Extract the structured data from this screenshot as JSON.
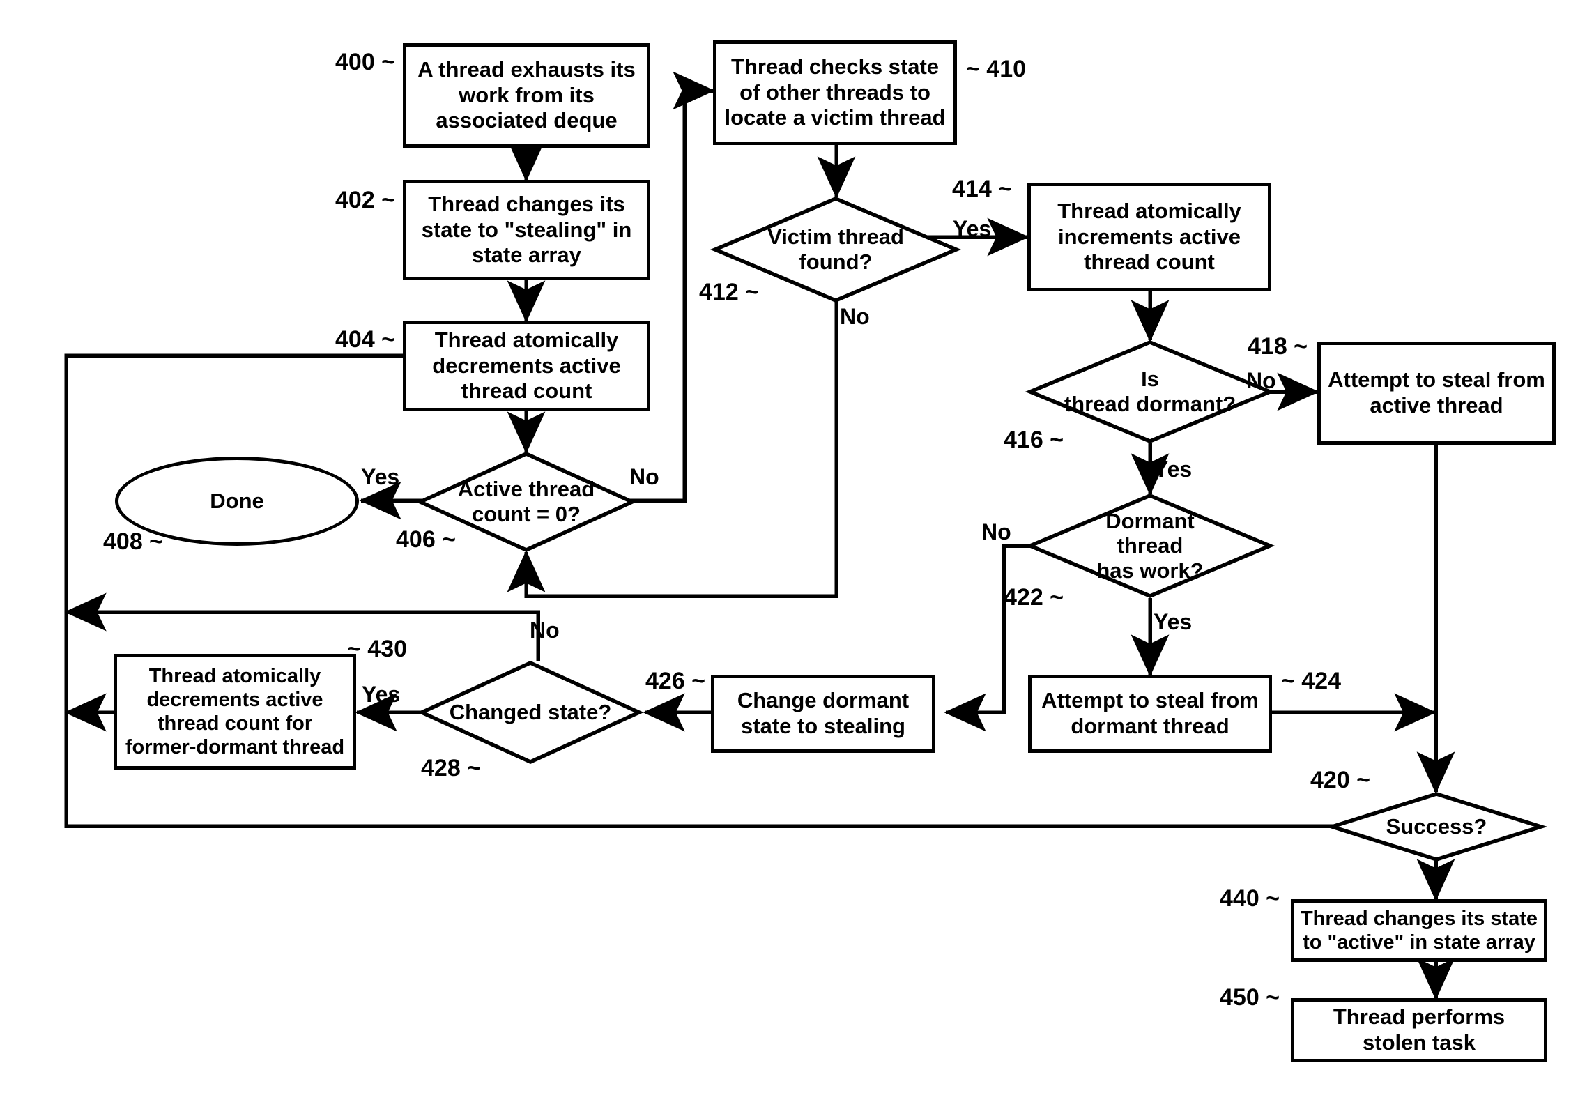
{
  "diagram": {
    "type": "flowchart",
    "title": "Work-stealing thread flow diagram",
    "nodes": [
      {
        "id": "400",
        "ref": "400 ~",
        "shape": "process",
        "text": "A thread exhausts its work from its associated deque"
      },
      {
        "id": "402",
        "ref": "402 ~",
        "shape": "process",
        "text": "Thread changes its state to \"stealing\" in state array"
      },
      {
        "id": "404",
        "ref": "404 ~",
        "shape": "process",
        "text": "Thread atomically decrements active thread count"
      },
      {
        "id": "406",
        "ref": "406 ~",
        "shape": "decision",
        "text": "Active thread\ncount = 0?"
      },
      {
        "id": "408",
        "ref": "408 ~",
        "shape": "terminal",
        "text": "Done"
      },
      {
        "id": "410",
        "ref": "~ 410",
        "shape": "process",
        "text": "Thread checks state of other threads to locate a victim thread"
      },
      {
        "id": "412",
        "ref": "412 ~",
        "shape": "decision",
        "text": "Victim thread\nfound?"
      },
      {
        "id": "414",
        "ref": "414 ~",
        "shape": "process",
        "text": "Thread atomically increments active thread count"
      },
      {
        "id": "416",
        "ref": "416 ~",
        "shape": "decision",
        "text": "Is\nthread dormant?"
      },
      {
        "id": "418",
        "ref": "418 ~",
        "shape": "process",
        "text": "Attempt to steal from active thread"
      },
      {
        "id": "420",
        "ref": "420 ~",
        "shape": "decision",
        "text": "Success?"
      },
      {
        "id": "422",
        "ref": "422 ~",
        "shape": "decision",
        "text": "Dormant\nthread\nhas work?"
      },
      {
        "id": "424",
        "ref": "~ 424",
        "shape": "process",
        "text": "Attempt to steal from dormant thread"
      },
      {
        "id": "426",
        "ref": "426 ~",
        "shape": "process",
        "text": "Change dormant state to stealing"
      },
      {
        "id": "428",
        "ref": "428 ~",
        "shape": "decision",
        "text": "Changed state?"
      },
      {
        "id": "430",
        "ref": "~ 430",
        "shape": "process",
        "text": "Thread atomically decrements active thread count for former-dormant thread"
      },
      {
        "id": "440",
        "ref": "440 ~",
        "shape": "process",
        "text": "Thread changes its state to \"active\" in state array"
      },
      {
        "id": "450",
        "ref": "450 ~",
        "shape": "process",
        "text": "Thread performs stolen task"
      }
    ],
    "edge_labels": {
      "e406_yes": "Yes",
      "e406_no": "No",
      "e412_yes": "Yes",
      "e412_no": "No",
      "e416_no": "No",
      "e416_yes": "Yes",
      "e422_no": "No",
      "e422_yes": "Yes",
      "e428_no": "No",
      "e428_yes": "Yes"
    },
    "edges": [
      {
        "from": "400",
        "to": "402",
        "label": ""
      },
      {
        "from": "402",
        "to": "404",
        "label": ""
      },
      {
        "from": "404",
        "to": "406",
        "label": ""
      },
      {
        "from": "406",
        "to": "408",
        "label": "Yes"
      },
      {
        "from": "406",
        "to": "410",
        "label": "No"
      },
      {
        "from": "410",
        "to": "412",
        "label": ""
      },
      {
        "from": "412",
        "to": "414",
        "label": "Yes"
      },
      {
        "from": "412",
        "to": "406",
        "label": "No"
      },
      {
        "from": "414",
        "to": "416",
        "label": ""
      },
      {
        "from": "416",
        "to": "418",
        "label": "No"
      },
      {
        "from": "416",
        "to": "422",
        "label": "Yes"
      },
      {
        "from": "418",
        "to": "420",
        "label": ""
      },
      {
        "from": "422",
        "to": "424",
        "label": "Yes"
      },
      {
        "from": "422",
        "to": "426",
        "label": "No"
      },
      {
        "from": "424",
        "to": "420",
        "label": ""
      },
      {
        "from": "426",
        "to": "428",
        "label": ""
      },
      {
        "from": "428",
        "to": "430",
        "label": "Yes"
      },
      {
        "from": "428",
        "to": "404",
        "label": "No"
      },
      {
        "from": "430",
        "to": "404",
        "label": ""
      },
      {
        "from": "420",
        "to": "440",
        "label": ""
      },
      {
        "from": "420",
        "to": "404",
        "label": ""
      },
      {
        "from": "440",
        "to": "450",
        "label": ""
      }
    ],
    "colors": {
      "stroke": "#000000",
      "fill": "#ffffff",
      "text": "#000000"
    }
  }
}
